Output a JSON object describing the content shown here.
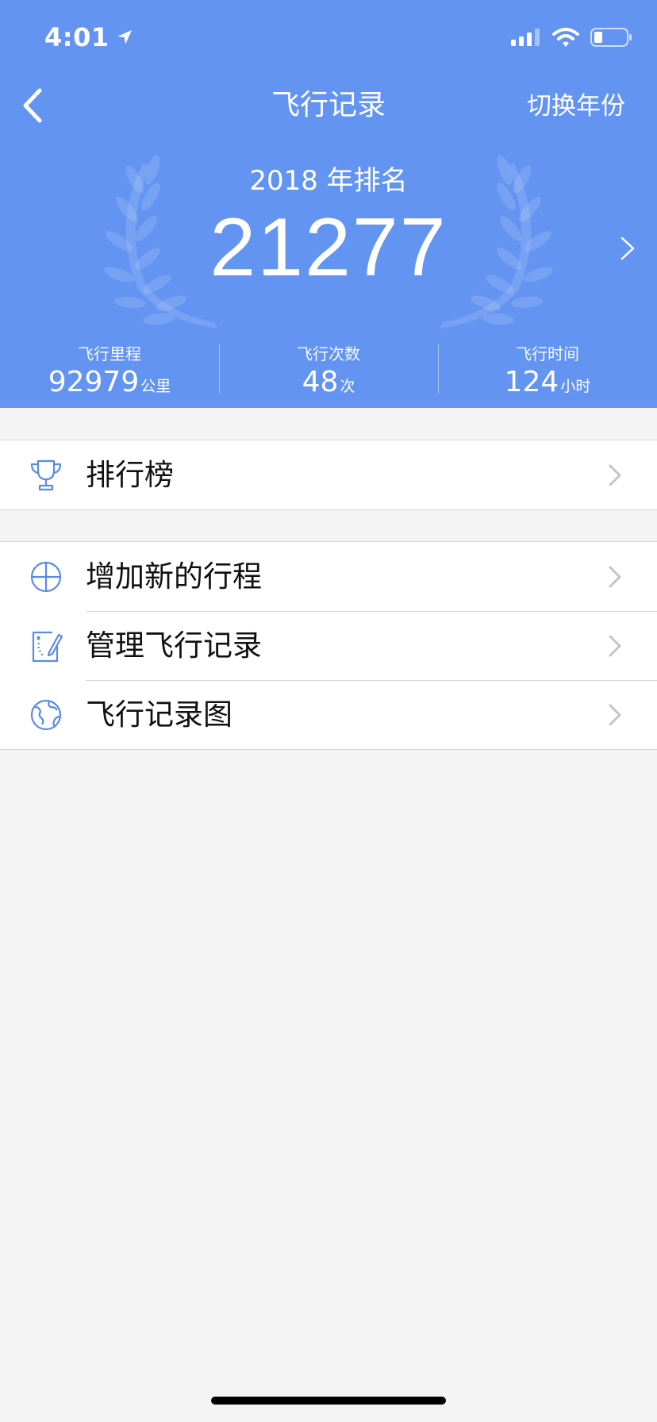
{
  "status_bar": {
    "time": "4:01"
  },
  "nav": {
    "title": "飞行记录",
    "right_label": "切换年份"
  },
  "rank": {
    "year_label": "2018 年排名",
    "value": "21277"
  },
  "stats": [
    {
      "label": "飞行里程",
      "value": "92979",
      "unit": "公里"
    },
    {
      "label": "飞行次数",
      "value": "48",
      "unit": "次"
    },
    {
      "label": "飞行时间",
      "value": "124",
      "unit": "小时"
    }
  ],
  "menu": {
    "leaderboard": "排行榜",
    "add_trip": "增加新的行程",
    "manage_records": "管理飞行记录",
    "records_map": "飞行记录图"
  },
  "colors": {
    "accent": "#6394f1",
    "icon": "#5b8ae6"
  }
}
